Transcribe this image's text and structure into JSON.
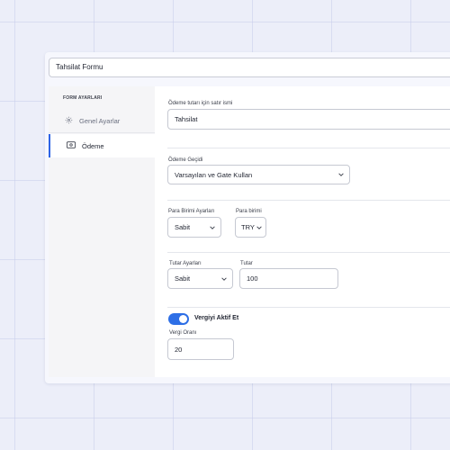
{
  "form": {
    "title": "Tahsilat Formu"
  },
  "sidebar": {
    "heading": "FORM AYARLARI",
    "items": [
      {
        "label": "Genel Ayarlar",
        "icon": "gear-icon",
        "active": false
      },
      {
        "label": "Ödeme",
        "icon": "payment-icon",
        "active": true
      }
    ]
  },
  "payment": {
    "row_name": {
      "label": "Ödeme tutarı için satır ismi",
      "value": "Tahsilat"
    },
    "gateway": {
      "label": "Ödeme Geçidi",
      "value": "Varsayılan ve Gate Kullan"
    },
    "currency_settings": {
      "label": "Para Birimi Ayarları",
      "value": "Sabit"
    },
    "currency": {
      "label": "Para birimi",
      "value": "TRY"
    },
    "amount_settings": {
      "label": "Tutar Ayarları",
      "value": "Sabit"
    },
    "amount": {
      "label": "Tutar",
      "value": "100"
    },
    "tax_toggle": {
      "label": "Vergiyi Aktif Et",
      "enabled": true
    },
    "tax_rate": {
      "label": "Vergi Oranı",
      "value": "20"
    }
  },
  "colors": {
    "accent": "#2e6fe6",
    "background": "#eceef9"
  }
}
